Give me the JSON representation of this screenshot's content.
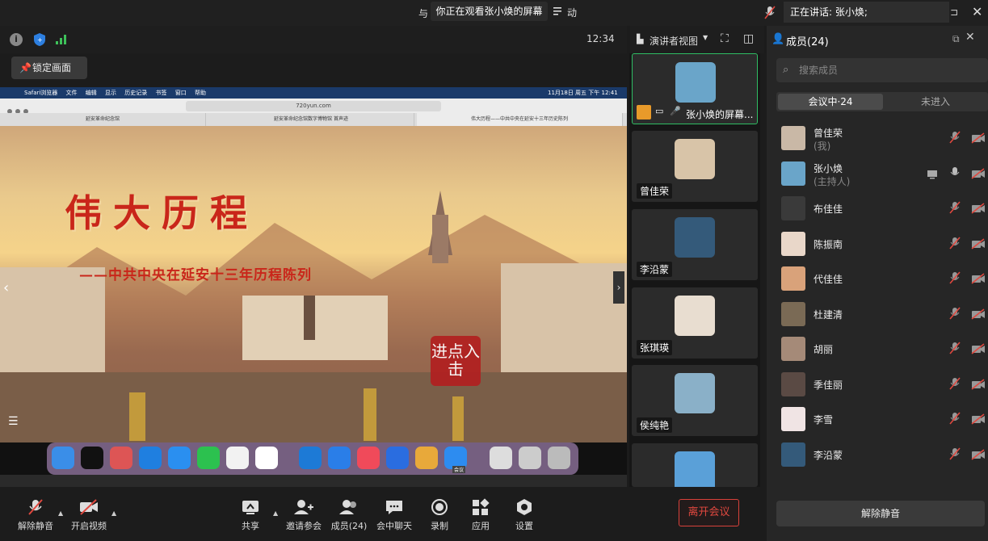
{
  "top_banner": {
    "left_text": "与",
    "viewing": "你正在观看张小焕的屏幕",
    "right_text": "动"
  },
  "speaking": "正在讲话: 张小焕;",
  "clock": "12:34",
  "lock_view": "锁定画面",
  "view_mode": "演讲者视图",
  "shared_screen": {
    "mac_menu": [
      "Safari浏览器",
      "文件",
      "编辑",
      "显示",
      "历史记录",
      "书签",
      "窗口",
      "帮助"
    ],
    "mac_status": "11月18日 周五 下午 12:41",
    "url": "720yun.com",
    "tabs": [
      "延安革命纪念馆",
      "延安革命纪念馆数字博物馆 首声迹",
      "伟大历程——中共中央在延安十三年历史陈列"
    ],
    "poster_title": "伟大历程",
    "poster_subtitle": "——中共中央在延安十三年历程陈列",
    "enter_button": "进点入击",
    "dock_label": "会议"
  },
  "thumbnails": [
    {
      "name": "张小焕的屏幕...",
      "color": "#6aa5c9"
    },
    {
      "name": "曾佳荣",
      "color": "#d8c4a8"
    },
    {
      "name": "李沿蒙",
      "color": "#345a7a"
    },
    {
      "name": "张琪瑛",
      "color": "#e8ddd0"
    },
    {
      "name": "侯纯艳",
      "color": "#8ab0c8"
    },
    {
      "name": "",
      "color": "#5aa0d8"
    }
  ],
  "members_panel": {
    "title": "成员(24)",
    "search_placeholder": "搜索成员",
    "tab_in_meeting": "会议中·24",
    "tab_not_joined": "未进入",
    "members": [
      {
        "name": "曾佳荣",
        "sub": "(我)",
        "color": "#c9b8a6"
      },
      {
        "name": "张小焕",
        "sub": "(主持人)",
        "color": "#6aa5c9"
      },
      {
        "name": "布佳佳",
        "sub": "",
        "color": "#3a3a3a"
      },
      {
        "name": "陈振南",
        "sub": "",
        "color": "#e9d7c9"
      },
      {
        "name": "代佳佳",
        "sub": "",
        "color": "#d9a27a"
      },
      {
        "name": "杜建清",
        "sub": "",
        "color": "#7a6a55"
      },
      {
        "name": "胡丽",
        "sub": "",
        "color": "#a58a78"
      },
      {
        "name": "季佳丽",
        "sub": "",
        "color": "#5a4a44"
      },
      {
        "name": "李雪",
        "sub": "",
        "color": "#f0e4e4"
      },
      {
        "name": "李沿蒙",
        "sub": "",
        "color": "#345a7a"
      }
    ],
    "unmute_all": "解除静音"
  },
  "toolbar": {
    "unmute": "解除静音",
    "start_video": "开启视频",
    "share": "共享",
    "invite": "邀请参会",
    "members": "成员(24)",
    "chat": "会中聊天",
    "record": "录制",
    "apps": "应用",
    "settings": "设置",
    "leave": "离开会议"
  }
}
